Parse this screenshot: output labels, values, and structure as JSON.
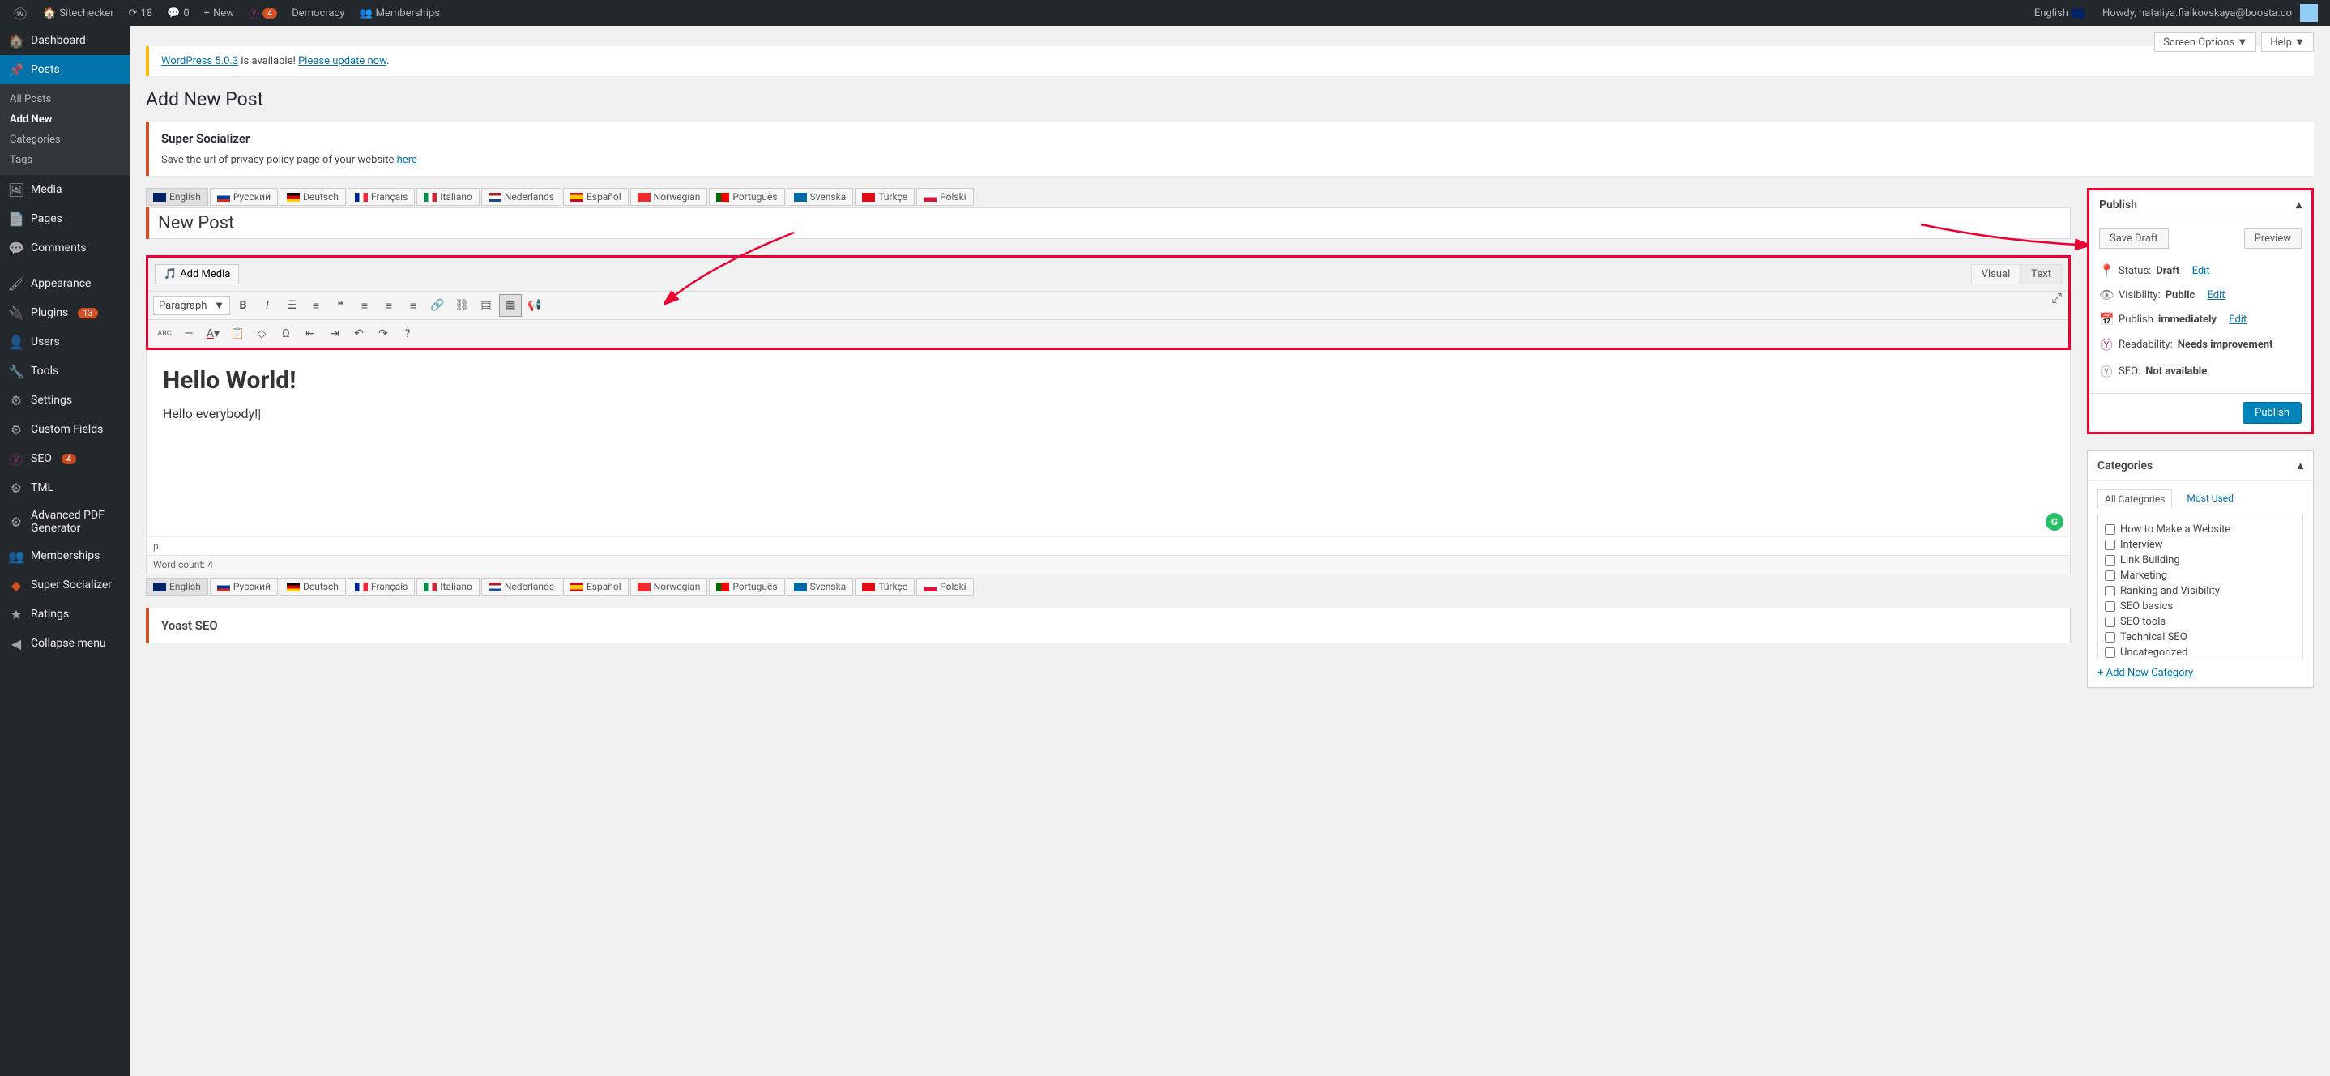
{
  "toolbar": {
    "site": "Sitechecker",
    "refresh": "18",
    "comments": "0",
    "new": "New",
    "yoast_count": "4",
    "democracy": "Democracy",
    "memberships": "Memberships",
    "language": "English",
    "howdy": "Howdy, nataliya.fialkovskaya@boosta.co"
  },
  "top_opts": {
    "screen": "Screen Options ▼",
    "help": "Help ▼"
  },
  "sidebar": {
    "dashboard": "Dashboard",
    "posts": "Posts",
    "posts_sub": {
      "all": "All Posts",
      "add": "Add New",
      "cats": "Categories",
      "tags": "Tags"
    },
    "media": "Media",
    "pages": "Pages",
    "comments": "Comments",
    "appearance": "Appearance",
    "plugins": "Plugins",
    "plugins_badge": "13",
    "users": "Users",
    "tools": "Tools",
    "settings": "Settings",
    "custom_fields": "Custom Fields",
    "seo": "SEO",
    "seo_badge": "4",
    "tml": "TML",
    "apdf": "Advanced PDF Generator",
    "memberships": "Memberships",
    "ss": "Super Socializer",
    "ratings": "Ratings",
    "collapse": "Collapse menu"
  },
  "notice": {
    "pre": "WordPress 5.0.3",
    "mid": " is available! ",
    "link": "Please update now"
  },
  "page_title": "Add New Post",
  "ss_notice": {
    "title": "Super Socializer",
    "text": "Save the url of privacy policy page of your website ",
    "link": "here"
  },
  "langs": [
    "English",
    "Русский",
    "Deutsch",
    "Français",
    "Italiano",
    "Nederlands",
    "Español",
    "Norwegian",
    "Português",
    "Svenska",
    "Türkçe",
    "Polski"
  ],
  "title_value": "New Post",
  "editor": {
    "add_media": "Add Media",
    "visual": "Visual",
    "text": "Text",
    "format": "Paragraph",
    "abc": "ABC",
    "heading": "Hello World!",
    "para": "Hello everybody!",
    "path": "p",
    "wc": "Word count: 4"
  },
  "publish": {
    "title": "Publish",
    "save_draft": "Save Draft",
    "preview": "Preview",
    "status_l": "Status: ",
    "status_v": "Draft",
    "vis_l": "Visibility: ",
    "vis_v": "Public",
    "pub_l": "Publish ",
    "pub_v": "immediately",
    "edit": "Edit",
    "read_l": "Readability: ",
    "read_v": "Needs improvement",
    "seo_l": "SEO: ",
    "seo_v": "Not available",
    "btn": "Publish"
  },
  "cats": {
    "title": "Categories",
    "all": "All Categories",
    "most": "Most Used",
    "items": [
      "How to Make a Website",
      "Interview",
      "Link Building",
      "Marketing",
      "Ranking and Visibility",
      "SEO basics",
      "SEO tools",
      "Technical SEO",
      "Uncategorized"
    ],
    "add": "+ Add New Category"
  },
  "yoast_panel": "Yoast SEO"
}
